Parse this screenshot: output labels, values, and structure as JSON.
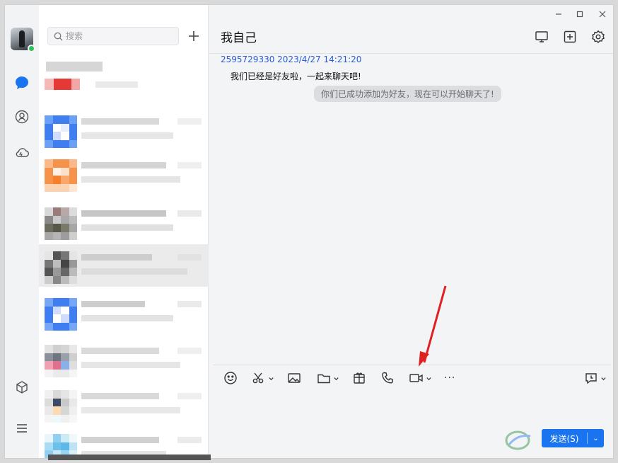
{
  "window": {
    "title": "我自己",
    "controls": [
      "minimize-icon",
      "maximize-icon",
      "close-icon"
    ]
  },
  "rail": {
    "items": [
      "message-icon",
      "contacts-icon",
      "cloud-icon",
      "apps-icon",
      "menu-icon"
    ],
    "status": "online"
  },
  "search": {
    "placeholder": "搜索",
    "value": ""
  },
  "chat": {
    "messages": [
      {
        "sender_and_time": "2595729330 2023/4/27 14:21:20",
        "text": "我们已经是好友啦，一起来聊天吧!"
      }
    ],
    "system_notice": "你们已成功添加为好友，现在可以开始聊天了!"
  },
  "toolbar": {
    "tools": [
      "emoji-icon",
      "scissors-icon",
      "image-icon",
      "folder-icon",
      "red-packet-icon",
      "phone-icon",
      "video-call-icon",
      "more-icon"
    ],
    "more_label": "···"
  },
  "send": {
    "label": "发送(S)",
    "caret": "⌄"
  },
  "colors": {
    "accent": "#1a74f0",
    "annotation_arrow": "#e02020",
    "online": "#2ec15a"
  }
}
